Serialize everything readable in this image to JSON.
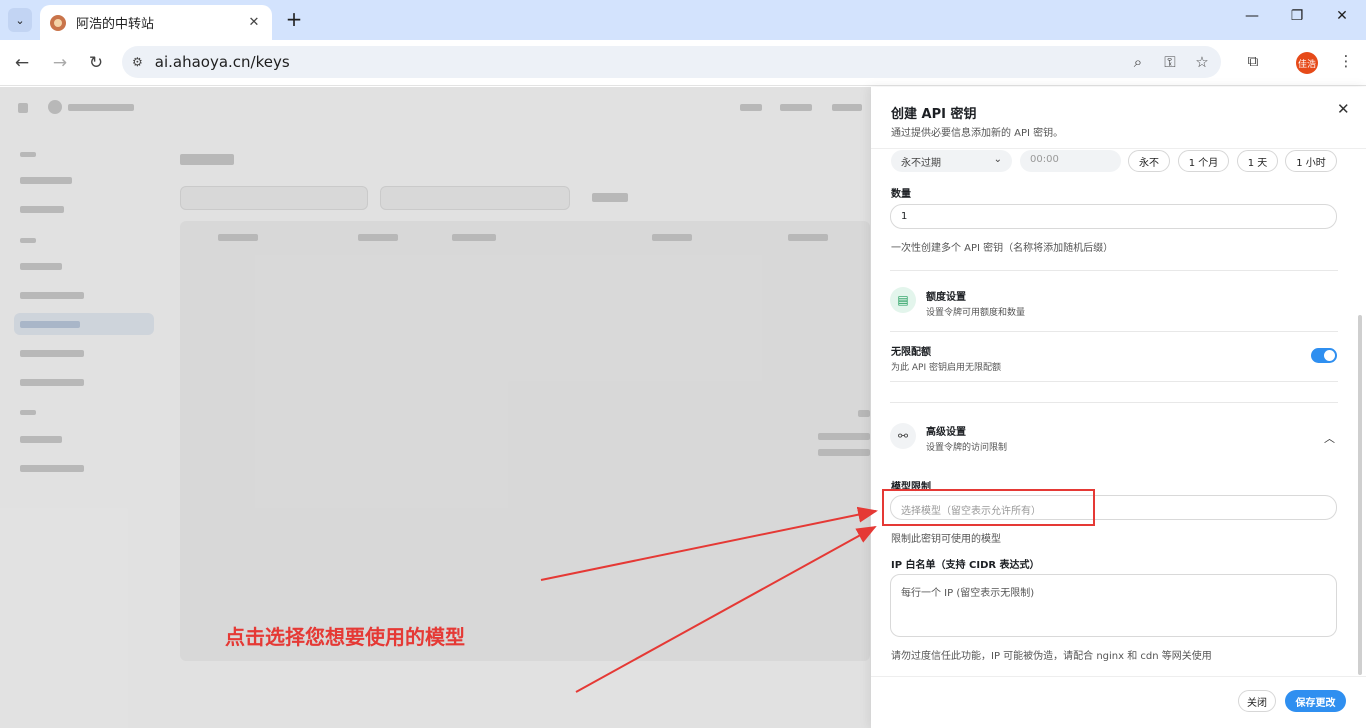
{
  "browser": {
    "tab_title": "阿浩的中转站",
    "url": "ai.ahaoya.cn/keys",
    "profile_label": "佳浩"
  },
  "drawer": {
    "title": "创建 API 密钥",
    "subtitle": "通过提供必要信息添加新的 API 密钥。",
    "expire_select": "永不过期",
    "time_placeholder": "00:00",
    "quick_buttons": [
      "永不",
      "1 个月",
      "1 天",
      "1 小时"
    ],
    "quantity_label": "数量",
    "quantity_value": "1",
    "quantity_hint": "一次性创建多个 API 密钥（名称将添加随机后缀）",
    "quota_section": {
      "title": "额度设置",
      "subtitle": "设置令牌可用额度和数量"
    },
    "unlimited": {
      "label": "无限配额",
      "hint": "为此 API 密钥启用无限配额",
      "enabled": true
    },
    "advanced_section": {
      "title": "高级设置",
      "subtitle": "设置令牌的访问限制"
    },
    "model_limit_label": "模型限制",
    "model_limit_placeholder": "选择模型（留空表示允许所有）",
    "model_limit_hint": "限制此密钥可使用的模型",
    "ip_label": "IP 白名单（支持 CIDR 表达式）",
    "ip_placeholder": "每行一个 IP (留空表示无限制)",
    "ip_hint": "请勿过度信任此功能，IP 可能被伪造，请配合 nginx 和 cdn 等网关使用",
    "close_button": "关闭",
    "save_button": "保存更改"
  },
  "annotation": {
    "text": "点击选择您想要使用的模型",
    "color": "#e53935"
  },
  "colors": {
    "accent": "#2f8ff0",
    "chrome": "#d3e3fd"
  }
}
